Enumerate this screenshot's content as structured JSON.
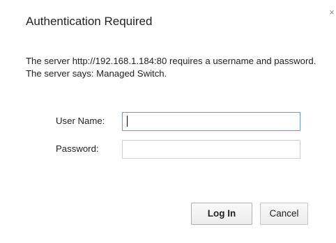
{
  "dialog": {
    "title": "Authentication Required",
    "close_glyph": "×",
    "message": "The server http://192.168.1.184:80 requires a username and password. The server says: Managed Switch.",
    "fields": {
      "username_label": "User Name:",
      "username_value": "",
      "password_label": "Password:",
      "password_value": ""
    },
    "buttons": {
      "login_label": "Log In",
      "cancel_label": "Cancel"
    }
  },
  "icons": [
    "close-icon"
  ],
  "colors": {
    "focus_border": "#6d9ed7",
    "input_border": "#cfcfcf",
    "button_border": "#c6c6c6",
    "text": "#222222"
  }
}
